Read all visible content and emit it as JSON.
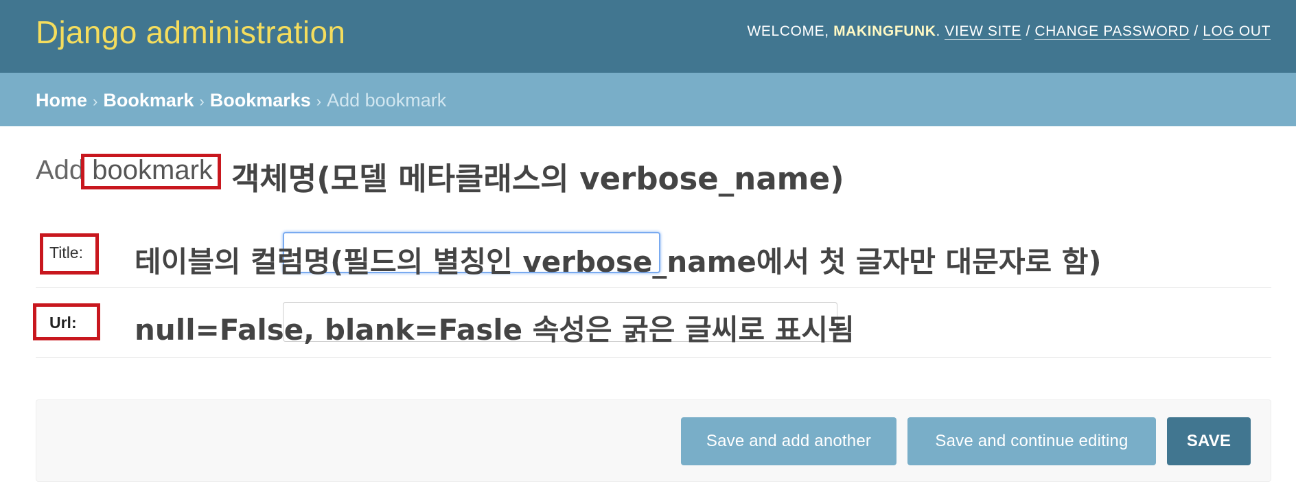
{
  "header": {
    "brand": "Django administration",
    "welcome": "WELCOME, ",
    "username": "MAKINGFUNK",
    "period": ". ",
    "view_site": "VIEW SITE",
    "sep": " / ",
    "change_password": "CHANGE PASSWORD",
    "log_out": "LOG OUT"
  },
  "breadcrumbs": {
    "items": [
      "Home",
      "Bookmark",
      "Bookmarks"
    ],
    "separator": "›",
    "current": "Add bookmark"
  },
  "page": {
    "title_prefix": "Add ",
    "title_object": "bookmark"
  },
  "annotations": {
    "title_note": "객체명(모델 메타클래스의 verbose_name)",
    "field_note": "테이블의 컬럼명(필드의 별칭인 verbose_name에서 첫 글자만 대문자로 함)",
    "url_note": "null=False, blank=Fasle 속성은 굵은 글씨로 표시됨",
    "highlight_color": "#c8171e"
  },
  "form": {
    "title_label": "Title:",
    "url_label": "Url:",
    "title_value": "",
    "url_value": ""
  },
  "buttons": {
    "save_add_another": "Save and add another",
    "save_continue": "Save and continue editing",
    "save": "SAVE"
  },
  "colors": {
    "header_bg": "#417690",
    "breadcrumb_bg": "#79aec8",
    "brand": "#f5dd5d",
    "primary_button": "#417690",
    "secondary_button": "#79aec8"
  }
}
